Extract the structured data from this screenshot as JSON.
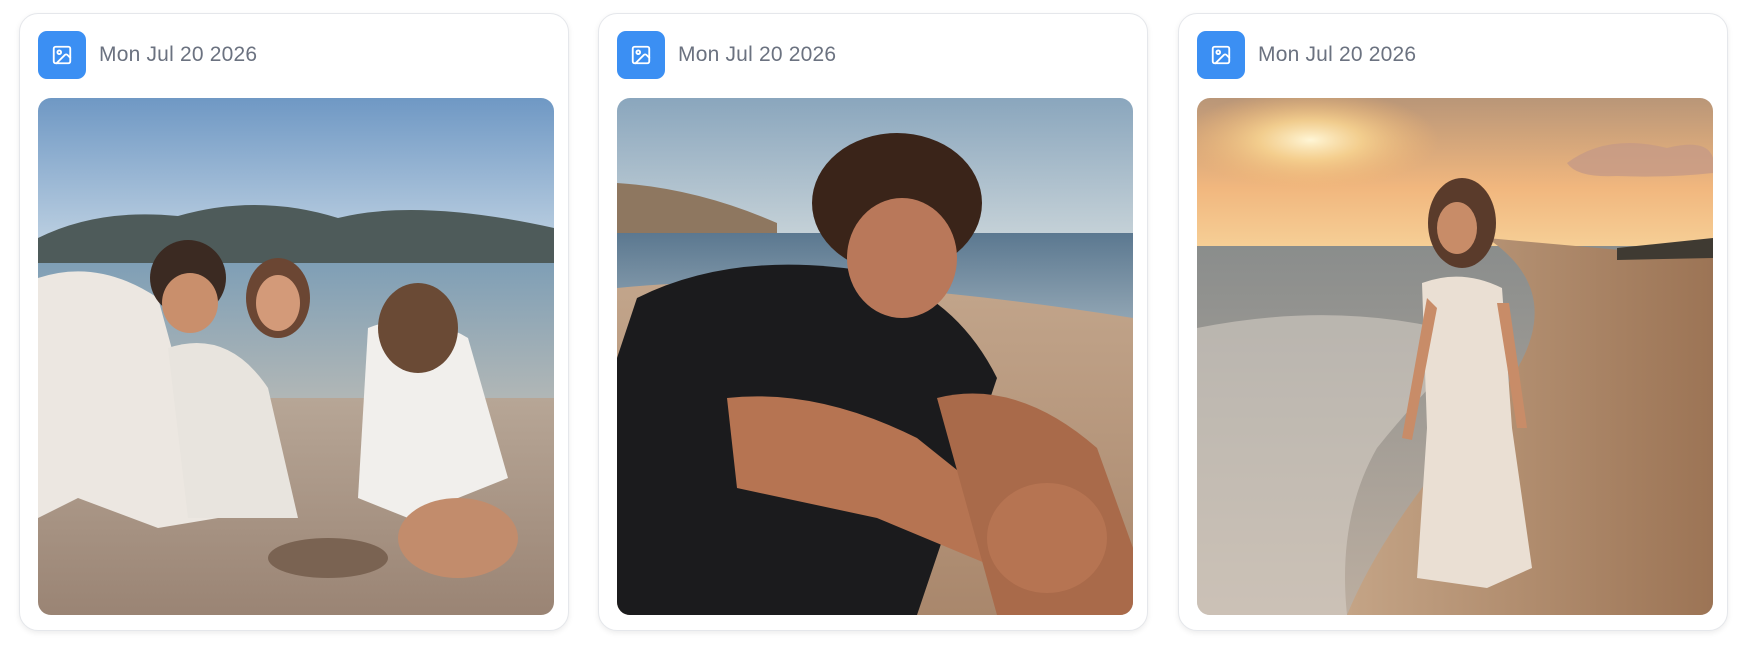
{
  "cards": [
    {
      "date": "Mon Jul 20 2026",
      "icon": "image-icon",
      "image": "beach-friends-digging-sand-photo"
    },
    {
      "date": "Mon Jul 20 2026",
      "icon": "image-icon",
      "image": "beach-young-man-sitting-photo"
    },
    {
      "date": "Mon Jul 20 2026",
      "icon": "image-icon",
      "image": "beach-woman-sunset-walk-photo"
    }
  ],
  "colors": {
    "icon_bg": "#3b8ff3",
    "date_text": "#6b7280",
    "card_border": "#e5e7eb"
  }
}
